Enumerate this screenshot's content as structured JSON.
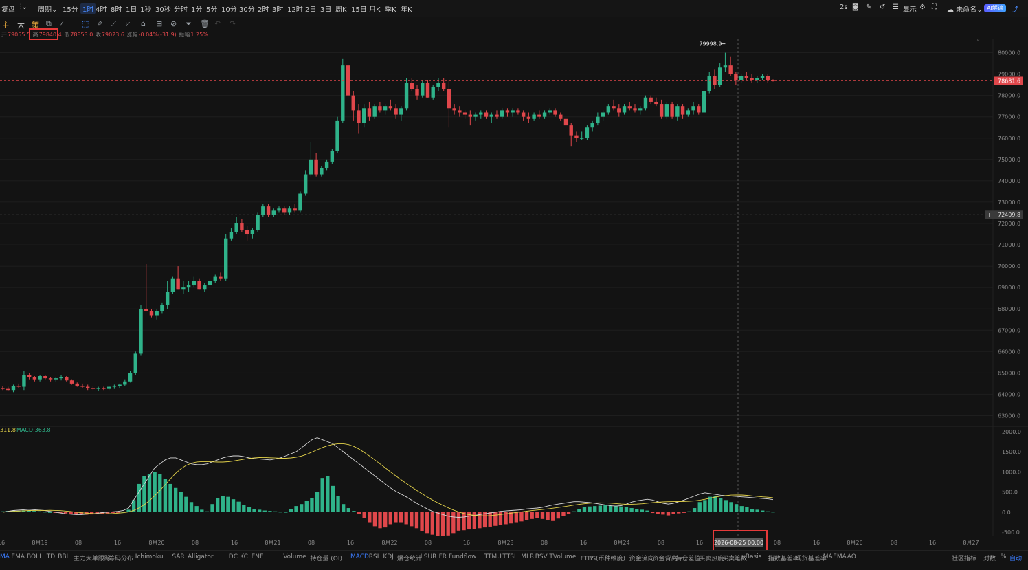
{
  "topbar": {
    "replay": "复盘",
    "chart_type_icon": "candles-icon",
    "period_menu": "周期",
    "intervals": [
      "15分",
      "1时",
      "4时",
      "8时",
      "1日",
      "1秒",
      "30秒",
      "分时",
      "1分",
      "5分",
      "10分",
      "30分",
      "2时",
      "3时",
      "12时",
      "2日",
      "3日",
      "周K",
      "15日",
      "月K",
      "季K",
      "年K"
    ],
    "active_interval": "1时",
    "refresh": "2s",
    "display": "显示",
    "layout_name": "未命名",
    "ai_label": "AI解读"
  },
  "toolbar": {
    "main": "主",
    "big": "大",
    "strategy": "策"
  },
  "ohlc": {
    "open_label": "开",
    "open": "79055.5",
    "high_label": "高",
    "high": "79840.4",
    "low_label": "低",
    "low": "78853.0",
    "close_label": "收",
    "close": "79023.6",
    "change_label": "涨幅",
    "change": "-0.04%(-31.9)",
    "amp_label": "振幅",
    "amp": "1.25%"
  },
  "price_axis": {
    "ticks": [
      "80000.0",
      "79000.0",
      "78000.0",
      "77000.0",
      "76000.0",
      "75000.0",
      "74000.0",
      "73000.0",
      "72000.0",
      "71000.0",
      "70000.0",
      "69000.0",
      "68000.0",
      "67000.0",
      "66000.0",
      "65000.0",
      "64000.0",
      "63000.0"
    ],
    "current_price": "78681.6",
    "cursor_price": "72409.8",
    "max_label": "79998.9"
  },
  "macd": {
    "dif_label": "311.8",
    "macd_label": "MACD:363.8",
    "ticks": [
      "2000.0",
      "1500.0",
      "1000.0",
      "500.0",
      "0.0",
      "-500.0"
    ]
  },
  "time_axis": {
    "labels": [
      "16",
      "8月19",
      "08",
      "16",
      "8月20",
      "08",
      "16",
      "8月21",
      "08",
      "16",
      "8月22",
      "08",
      "16",
      "8月23",
      "08",
      "16",
      "8月24",
      "08",
      "16",
      "08",
      "16",
      "8月26",
      "08",
      "16",
      "8月27"
    ],
    "cursor_time": "2026-08-25 00:00"
  },
  "indicators_left": [
    "MA",
    "EMA",
    "BOLL",
    "TD",
    "BBI",
    "主力大单跟踪",
    "筹码分布",
    "Ichimoku",
    "SAR",
    "Alligator",
    "DC",
    "KC",
    "ENE"
  ],
  "indicators_right": [
    "Volume",
    "持仓量 (OI)",
    "MACD",
    "RSI",
    "KDJ",
    "爆仓统计",
    "LSUR",
    "FR",
    "Fundflow",
    "TTMU",
    "TTSI",
    "MLR",
    "BSV",
    "TVolume",
    "FTBS(币种维度)",
    "资金流向",
    "资金背离",
    "持仓差值",
    "买卖热度",
    "买卖笔数",
    "Basis",
    "指数基差率",
    "现货基差率",
    "MA",
    "EMA",
    "AO"
  ],
  "community_indicators": "社区指标",
  "bottom_right": [
    "对数",
    "%",
    "自动"
  ],
  "colors": {
    "up": "#2fb38a",
    "down": "#e0474b",
    "accent": "#3b7cff",
    "dif": "#d9d9d9",
    "dea": "#e3d24a"
  },
  "chart_data": {
    "type": "candlestick",
    "interval": "1时",
    "ylim": [
      62500,
      80500
    ],
    "macd_ylim": [
      -600,
      2100
    ],
    "candles": [
      [
        64300,
        64400,
        64200,
        64250
      ],
      [
        64250,
        64350,
        64150,
        64200
      ],
      [
        64200,
        64450,
        64100,
        64400
      ],
      [
        64400,
        64500,
        64300,
        64350
      ],
      [
        64350,
        65100,
        64200,
        64900
      ],
      [
        64900,
        65000,
        64700,
        64800
      ],
      [
        64800,
        64850,
        64600,
        64700
      ],
      [
        64700,
        64900,
        64600,
        64850
      ],
      [
        64850,
        64900,
        64700,
        64750
      ],
      [
        64750,
        64800,
        64600,
        64700
      ],
      [
        64700,
        64800,
        64600,
        64750
      ],
      [
        64750,
        64900,
        64650,
        64800
      ],
      [
        64800,
        64850,
        64600,
        64650
      ],
      [
        64650,
        64700,
        64450,
        64500
      ],
      [
        64500,
        64550,
        64350,
        64400
      ],
      [
        64400,
        64500,
        64300,
        64350
      ],
      [
        64350,
        64450,
        64200,
        64300
      ],
      [
        64300,
        64400,
        64200,
        64250
      ],
      [
        64250,
        64350,
        64150,
        64300
      ],
      [
        64300,
        64350,
        64200,
        64250
      ],
      [
        64250,
        64400,
        64200,
        64350
      ],
      [
        64350,
        64450,
        64250,
        64400
      ],
      [
        64400,
        64500,
        64300,
        64450
      ],
      [
        64450,
        64700,
        64400,
        64600
      ],
      [
        64600,
        65100,
        64550,
        65000
      ],
      [
        65000,
        66000,
        64900,
        65900
      ],
      [
        65900,
        68200,
        65800,
        68000
      ],
      [
        68000,
        70100,
        67900,
        67900
      ],
      [
        67900,
        68000,
        67600,
        67700
      ],
      [
        67700,
        68000,
        67500,
        67900
      ],
      [
        67900,
        68300,
        67800,
        68200
      ],
      [
        68200,
        69300,
        68000,
        68800
      ],
      [
        68800,
        69500,
        68700,
        69400
      ],
      [
        69400,
        70000,
        68900,
        68900
      ],
      [
        68900,
        69300,
        68700,
        69000
      ],
      [
        69000,
        69300,
        68800,
        69100
      ],
      [
        69100,
        69500,
        69000,
        69300
      ],
      [
        69300,
        69400,
        68900,
        68900
      ],
      [
        68900,
        69200,
        68800,
        69100
      ],
      [
        69100,
        69400,
        69000,
        69300
      ],
      [
        69300,
        69600,
        69200,
        69500
      ],
      [
        69500,
        69700,
        69300,
        69400
      ],
      [
        69400,
        71500,
        69300,
        71300
      ],
      [
        71300,
        71800,
        71200,
        71600
      ],
      [
        71600,
        72300,
        71500,
        72000
      ],
      [
        72000,
        72200,
        71600,
        71700
      ],
      [
        71700,
        71900,
        71200,
        71500
      ],
      [
        71500,
        71800,
        71300,
        71700
      ],
      [
        71700,
        72500,
        71600,
        72400
      ],
      [
        72400,
        72900,
        72300,
        72800
      ],
      [
        72800,
        72900,
        72300,
        72400
      ],
      [
        72400,
        72700,
        72300,
        72600
      ],
      [
        72600,
        72800,
        72500,
        72700
      ],
      [
        72700,
        72800,
        72400,
        72500
      ],
      [
        72500,
        72800,
        72400,
        72700
      ],
      [
        72700,
        72900,
        72500,
        72600
      ],
      [
        72600,
        73500,
        72500,
        73400
      ],
      [
        73400,
        74500,
        73300,
        74300
      ],
      [
        74300,
        75800,
        74200,
        75000
      ],
      [
        75000,
        75300,
        74200,
        74300
      ],
      [
        74300,
        74700,
        74200,
        74600
      ],
      [
        74600,
        75000,
        74500,
        74900
      ],
      [
        74900,
        75500,
        74800,
        75400
      ],
      [
        75400,
        77000,
        75300,
        76800
      ],
      [
        76800,
        79700,
        76700,
        79400
      ],
      [
        79400,
        79500,
        77800,
        78000
      ],
      [
        78000,
        78200,
        76800,
        77300
      ],
      [
        77300,
        77600,
        76200,
        76700
      ],
      [
        76700,
        77600,
        76500,
        77400
      ],
      [
        77400,
        77700,
        76800,
        77000
      ],
      [
        77000,
        77600,
        76900,
        77500
      ],
      [
        77500,
        77700,
        77200,
        77300
      ],
      [
        77300,
        77600,
        77100,
        77500
      ],
      [
        77500,
        77800,
        77300,
        77400
      ],
      [
        77400,
        77600,
        76900,
        77100
      ],
      [
        77100,
        77500,
        76800,
        77400
      ],
      [
        77400,
        78800,
        77300,
        78600
      ],
      [
        78600,
        78800,
        78200,
        78300
      ],
      [
        78300,
        78500,
        77800,
        78000
      ],
      [
        78000,
        78700,
        77900,
        78600
      ],
      [
        78600,
        78700,
        77900,
        77900
      ],
      [
        77900,
        78500,
        77800,
        78400
      ],
      [
        78400,
        78800,
        78200,
        78600
      ],
      [
        78600,
        78800,
        78200,
        78300
      ],
      [
        78300,
        78700,
        76500,
        77400
      ],
      [
        77400,
        77600,
        77100,
        77300
      ],
      [
        77300,
        77500,
        77000,
        77200
      ],
      [
        77200,
        77300,
        76900,
        77100
      ],
      [
        77100,
        77300,
        76600,
        77000
      ],
      [
        77000,
        77200,
        76800,
        77100
      ],
      [
        77100,
        77300,
        76900,
        77200
      ],
      [
        77200,
        77300,
        76900,
        77000
      ],
      [
        77000,
        77200,
        76700,
        77100
      ],
      [
        77100,
        77300,
        76900,
        77000
      ],
      [
        77000,
        77400,
        76900,
        77300
      ],
      [
        77300,
        77400,
        77000,
        77200
      ],
      [
        77200,
        77400,
        77000,
        77300
      ],
      [
        77300,
        77400,
        77100,
        77200
      ],
      [
        77200,
        77300,
        76800,
        77000
      ],
      [
        77000,
        77200,
        76700,
        76900
      ],
      [
        76900,
        77200,
        76800,
        77100
      ],
      [
        77100,
        77300,
        76900,
        77000
      ],
      [
        77000,
        77300,
        76900,
        77200
      ],
      [
        77200,
        77400,
        77100,
        77300
      ],
      [
        77300,
        77400,
        77000,
        77100
      ],
      [
        77100,
        77200,
        76800,
        76900
      ],
      [
        76900,
        77000,
        76400,
        76600
      ],
      [
        76600,
        76700,
        75600,
        76100
      ],
      [
        76100,
        76300,
        75800,
        76000
      ],
      [
        76000,
        76300,
        75900,
        76000
      ],
      [
        76000,
        76600,
        75900,
        76500
      ],
      [
        76500,
        76800,
        76300,
        76700
      ],
      [
        76700,
        77200,
        76600,
        77000
      ],
      [
        77000,
        77300,
        76800,
        77200
      ],
      [
        77200,
        77600,
        77100,
        77500
      ],
      [
        77500,
        77800,
        77300,
        77400
      ],
      [
        77400,
        77600,
        77000,
        77200
      ],
      [
        77200,
        77600,
        77100,
        77500
      ],
      [
        77500,
        77700,
        77300,
        77400
      ],
      [
        77400,
        77600,
        77200,
        77300
      ],
      [
        77300,
        77500,
        77100,
        77400
      ],
      [
        77400,
        78000,
        77300,
        77900
      ],
      [
        77900,
        78000,
        77600,
        77700
      ],
      [
        77700,
        77900,
        77500,
        77600
      ],
      [
        77600,
        77800,
        76900,
        77000
      ],
      [
        77000,
        77700,
        76900,
        77600
      ],
      [
        77600,
        77700,
        76900,
        77000
      ],
      [
        77000,
        77600,
        76800,
        77500
      ],
      [
        77500,
        77600,
        76900,
        77100
      ],
      [
        77100,
        77400,
        77000,
        77300
      ],
      [
        77300,
        77700,
        77100,
        77500
      ],
      [
        77500,
        77600,
        77100,
        77200
      ],
      [
        77200,
        78300,
        77100,
        78200
      ],
      [
        78200,
        79100,
        78100,
        78900
      ],
      [
        78900,
        79200,
        78300,
        78500
      ],
      [
        78500,
        79500,
        78400,
        79300
      ],
      [
        79300,
        79998,
        79100,
        79400
      ],
      [
        79400,
        79800,
        78900,
        79000
      ],
      [
        79000,
        79100,
        78500,
        78700
      ],
      [
        78700,
        79000,
        78600,
        78900
      ],
      [
        78900,
        79100,
        78700,
        78800
      ],
      [
        78800,
        79000,
        78600,
        78700
      ],
      [
        78700,
        78900,
        78600,
        78800
      ],
      [
        78800,
        79000,
        78700,
        78900
      ],
      [
        78900,
        79000,
        78600,
        78700
      ],
      [
        78700,
        78750,
        78650,
        78681
      ]
    ],
    "macd_hist": [
      20,
      30,
      40,
      30,
      45,
      40,
      30,
      20,
      10,
      0,
      -10,
      -20,
      -30,
      -40,
      -50,
      -55,
      -60,
      -55,
      -50,
      -40,
      -30,
      -20,
      -10,
      10,
      60,
      300,
      700,
      900,
      950,
      1000,
      950,
      820,
      700,
      600,
      500,
      380,
      250,
      150,
      60,
      20,
      200,
      350,
      400,
      380,
      320,
      260,
      180,
      120,
      80,
      60,
      40,
      30,
      20,
      10,
      5,
      80,
      150,
      200,
      280,
      350,
      500,
      850,
      900,
      650,
      400,
      200,
      100,
      30,
      -50,
      -150,
      -250,
      -350,
      -400,
      -380,
      -300,
      -250,
      -250,
      -300,
      -350,
      -400,
      -480,
      -520,
      -560,
      -600,
      -600,
      -580,
      -520,
      -460,
      -450,
      -430,
      -420,
      -400,
      -380,
      -360,
      -340,
      -320,
      -300,
      -280,
      -250,
      -230,
      -200,
      -170,
      -150,
      -170,
      -200,
      -220,
      -160,
      -100,
      -50,
      20,
      80,
      120,
      140,
      150,
      160,
      170,
      160,
      150,
      140,
      120,
      100,
      80,
      60,
      40,
      -20,
      -40,
      -60,
      -80,
      -50,
      -30,
      -10,
      20,
      100,
      250,
      300,
      380,
      400,
      350,
      300,
      250,
      200,
      150,
      120,
      80,
      60,
      40,
      20,
      10
    ],
    "dif": [
      0,
      20,
      40,
      50,
      60,
      70,
      60,
      50,
      40,
      20,
      0,
      -20,
      -40,
      -50,
      -60,
      -60,
      -50,
      -40,
      -30,
      -10,
      0,
      10,
      20,
      40,
      100,
      300,
      500,
      700,
      900,
      1100,
      1200,
      1300,
      1350,
      1350,
      1300,
      1250,
      1200,
      1180,
      1180,
      1200,
      1250,
      1300,
      1350,
      1380,
      1400,
      1400,
      1380,
      1350,
      1330,
      1320,
      1310,
      1300,
      1320,
      1350,
      1400,
      1450,
      1500,
      1600,
      1700,
      1800,
      1850,
      1800,
      1750,
      1700,
      1600,
      1500,
      1400,
      1300,
      1200,
      1100,
      1000,
      900,
      800,
      700,
      600,
      520,
      450,
      380,
      300,
      220,
      150,
      80,
      20,
      -20,
      -60,
      -100,
      -120,
      -130,
      -120,
      -100,
      -80,
      -60,
      -40,
      -20,
      0,
      20,
      30,
      40,
      50,
      60,
      80,
      90,
      100,
      120,
      150,
      180,
      200,
      220,
      240,
      260,
      260,
      250,
      240,
      220,
      200,
      180,
      160,
      150,
      160,
      200,
      250,
      280,
      300,
      320,
      300,
      260,
      220,
      200,
      220,
      260,
      300,
      350,
      400,
      450,
      480,
      460,
      440,
      420,
      410,
      400,
      390,
      380,
      370,
      360,
      350,
      340,
      330,
      311
    ]
  }
}
